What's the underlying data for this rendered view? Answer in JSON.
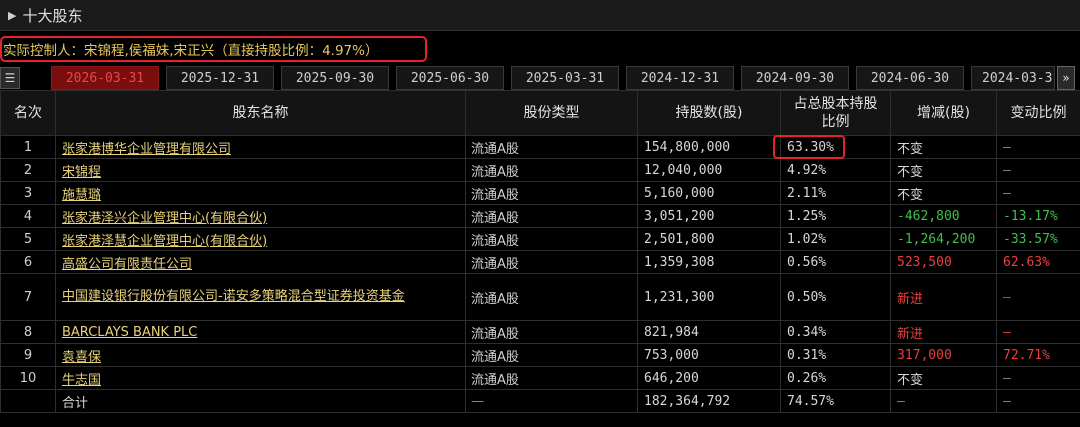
{
  "section": {
    "title": "十大股东"
  },
  "controller": {
    "text": "实际控制人：宋锦程,侯福妹,宋正兴（直接持股比例：4.97%）"
  },
  "tabs": [
    "2026-03-31",
    "2025-12-31",
    "2025-09-30",
    "2025-06-30",
    "2025-03-31",
    "2024-12-31",
    "2024-09-30",
    "2024-06-30",
    "2024-03-3"
  ],
  "active_tab": "2026-03-31",
  "table": {
    "headers": {
      "rank": "名次",
      "name": "股东名称",
      "type": "股份类型",
      "shares": "持股数(股)",
      "ratio": "占总股本持股比例",
      "change": "增减(股)",
      "change_ratio": "变动比例"
    },
    "rows": [
      {
        "rank": "1",
        "name": "张家港博华企业管理有限公司",
        "type": "流通A股",
        "shares": "154,800,000",
        "ratio": "63.30%",
        "change": "不变",
        "change_ratio": "—"
      },
      {
        "rank": "2",
        "name": "宋锦程",
        "type": "流通A股",
        "shares": "12,040,000",
        "ratio": "4.92%",
        "change": "不变",
        "change_ratio": "—"
      },
      {
        "rank": "3",
        "name": "施慧璐",
        "type": "流通A股",
        "shares": "5,160,000",
        "ratio": "2.11%",
        "change": "不变",
        "change_ratio": "—"
      },
      {
        "rank": "4",
        "name": "张家港泽兴企业管理中心(有限合伙)",
        "type": "流通A股",
        "shares": "3,051,200",
        "ratio": "1.25%",
        "change": "-462,800",
        "change_ratio": "-13.17%"
      },
      {
        "rank": "5",
        "name": "张家港泽慧企业管理中心(有限合伙)",
        "type": "流通A股",
        "shares": "2,501,800",
        "ratio": "1.02%",
        "change": "-1,264,200",
        "change_ratio": "-33.57%"
      },
      {
        "rank": "6",
        "name": "高盛公司有限责任公司",
        "type": "流通A股",
        "shares": "1,359,308",
        "ratio": "0.56%",
        "change": "523,500",
        "change_ratio": "62.63%"
      },
      {
        "rank": "7",
        "name": "中国建设银行股份有限公司-诺安多策略混合型证券投资基金",
        "type": "流通A股",
        "shares": "1,231,300",
        "ratio": "0.50%",
        "change": "新进",
        "change_ratio": "—"
      },
      {
        "rank": "8",
        "name": "BARCLAYS BANK PLC",
        "type": "流通A股",
        "shares": "821,984",
        "ratio": "0.34%",
        "change": "新进",
        "change_ratio": "—"
      },
      {
        "rank": "9",
        "name": "袁喜保",
        "type": "流通A股",
        "shares": "753,000",
        "ratio": "0.31%",
        "change": "317,000",
        "change_ratio": "72.71%"
      },
      {
        "rank": "10",
        "name": "牛志国",
        "type": "流通A股",
        "shares": "646,200",
        "ratio": "0.26%",
        "change": "不变",
        "change_ratio": "—"
      }
    ],
    "total": {
      "label": "合计",
      "type": "—",
      "shares": "182,364,792",
      "ratio": "74.57%",
      "change": "—",
      "change_ratio": "—"
    }
  },
  "colors": {
    "positive": "#e84040",
    "negative": "#3fbf4f",
    "link": "#e8d27a",
    "highlight": "#e8212f",
    "active_tab_bg": "#7a0d0d"
  }
}
